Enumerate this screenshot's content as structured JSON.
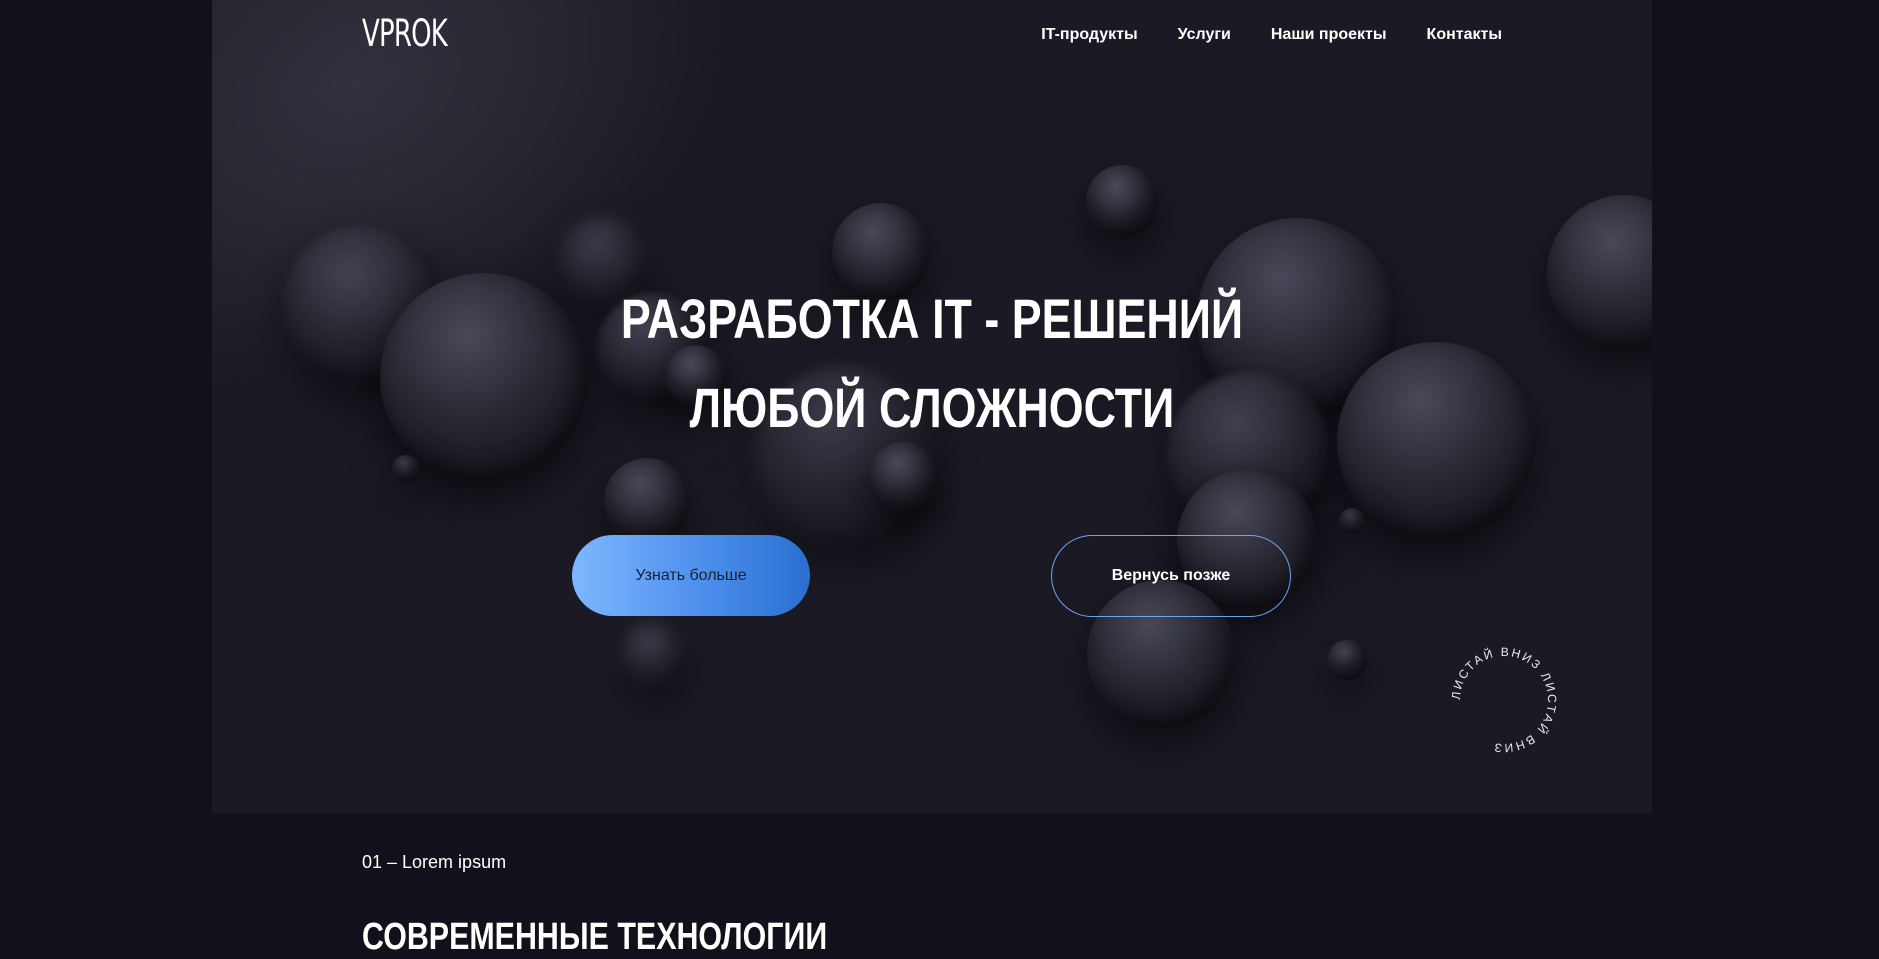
{
  "header": {
    "logo": "VPROK",
    "nav": [
      "IT-продукты",
      "Услуги",
      "Наши проекты",
      "Контакты"
    ]
  },
  "hero": {
    "headline_line1": "РАЗРАБОТКА IT - РЕШЕНИЙ",
    "headline_line2": "ЛЮБОЙ СЛОЖНОСТИ",
    "primary_button": "Узнать больше",
    "secondary_button": "Вернусь позже",
    "scroll_label": "ЛИСТАЙ ВНИЗ ЛИСТАЙ ВНИЗ"
  },
  "section": {
    "number": "01 – Lorem ipsum",
    "title": "СОВРЕМЕННЫЕ ТЕХНОЛОГИИ"
  },
  "colors": {
    "page_bg": "#12111b",
    "hero_bg": "#1b1a24",
    "accent_gradient_start": "#7fb7ff",
    "accent_gradient_end": "#2a6fd0",
    "outline_accent": "#6aa5f4"
  }
}
